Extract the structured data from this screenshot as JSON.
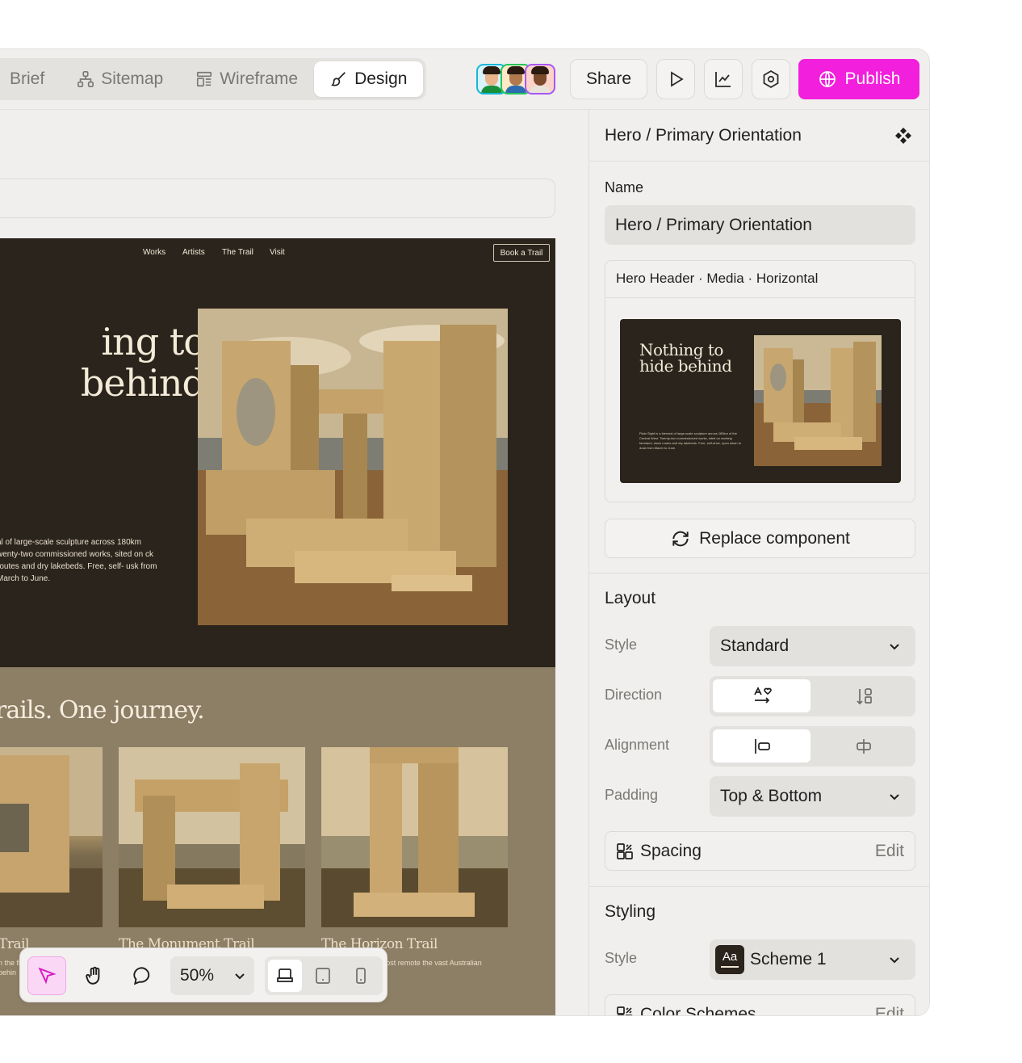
{
  "tabs": [
    {
      "label": "Brief",
      "icon": "brief-icon"
    },
    {
      "label": "Sitemap",
      "icon": "sitemap-icon"
    },
    {
      "label": "Wireframe",
      "icon": "wireframe-icon"
    },
    {
      "label": "Design",
      "icon": "brush-icon"
    }
  ],
  "header": {
    "share_label": "Share",
    "publish_label": "Publish",
    "collaborator_colors": [
      "#17b6d8",
      "#22c55e",
      "#a855f7"
    ]
  },
  "site": {
    "nav": [
      "Works",
      "Artists",
      "The Trail",
      "Visit"
    ],
    "cta": "Book a Trail",
    "hero_title_line1": "ing to",
    "hero_title_line2": "behind",
    "hero_desc": "al of large-scale sculpture across 180km wenty-two commissioned works, sited on ck routes and dry lakebeds. Free, self- usk from March to June.",
    "section_title": "rails. One journey.",
    "cards": [
      {
        "title": "Trail",
        "desc": "n the fi behin"
      },
      {
        "title": "The Monument Trail",
        "desc": ""
      },
      {
        "title": "The Horizon Trail",
        "desc": "ading to the trail's most remote the vast Australian landscape."
      }
    ]
  },
  "toolbar": {
    "zoom": "50%"
  },
  "panel": {
    "header_title": "Hero / Primary Orientation",
    "name_label": "Name",
    "name_value": "Hero / Primary Orientation",
    "component_title": "Hero Header · Media · Horizontal",
    "preview_title": "Nothing to hide behind",
    "preview_desc": "Plain Sight is a biennial of large-scale sculpture across 180km of the Central West. Twenty-two commissioned works, sited on working farmland, stock routes and dry lakebeds. Free, self-drive, open dawn to dusk from March to June.",
    "replace_label": "Replace component",
    "layout": {
      "section_title": "Layout",
      "style_label": "Style",
      "style_value": "Standard",
      "direction_label": "Direction",
      "alignment_label": "Alignment",
      "padding_label": "Padding",
      "padding_value": "Top & Bottom",
      "spacing_label": "Spacing",
      "spacing_edit": "Edit"
    },
    "styling": {
      "section_title": "Styling",
      "style_label": "Style",
      "scheme_badge": "Aa",
      "scheme_value": "Scheme 1",
      "color_schemes_label": "Color Schemes",
      "color_schemes_edit": "Edit"
    }
  },
  "colors": {
    "accent": "#f21fdc",
    "hero_bg": "#2b241c",
    "section_bg": "#8d7e66"
  }
}
